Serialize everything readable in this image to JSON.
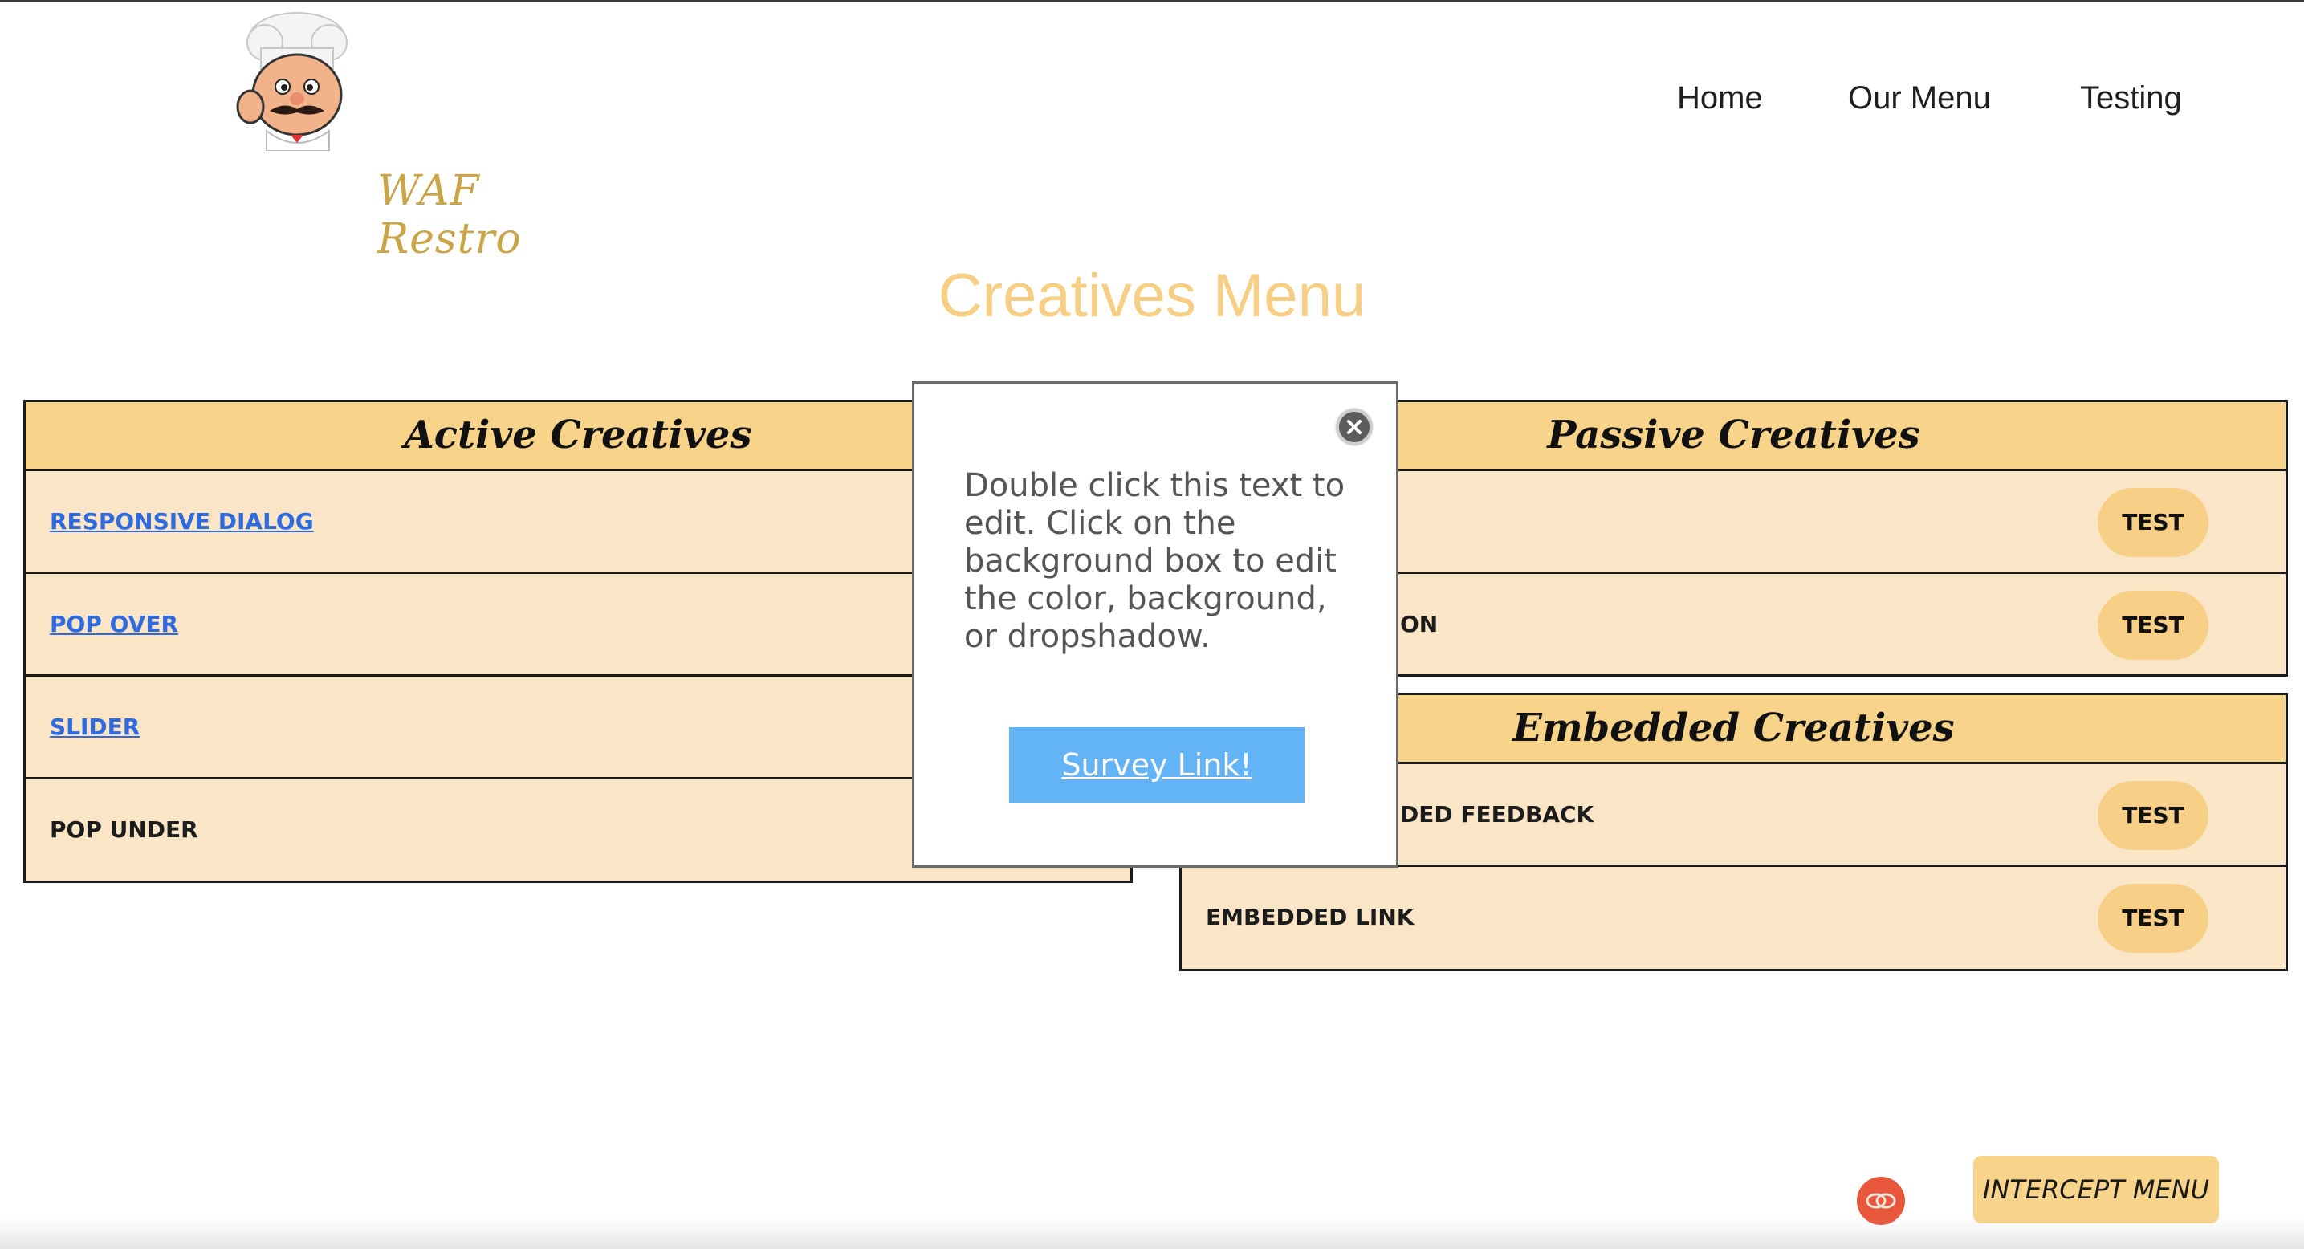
{
  "header": {
    "brand_name": "WAF Restro",
    "nav": [
      "Home",
      "Our Menu",
      "Testing"
    ]
  },
  "page_title": "Creatives Menu",
  "active_creatives": {
    "heading": "Active Creatives",
    "rows": [
      {
        "label": "RESPONSIVE DIALOG"
      },
      {
        "label": "POP OVER"
      },
      {
        "label": "SLIDER"
      },
      {
        "label": "POP UNDER"
      }
    ]
  },
  "passive_creatives": {
    "heading": "Passive Creatives",
    "rows": [
      {
        "label": "",
        "button": "TEST"
      },
      {
        "label": "ON",
        "button": "TEST"
      }
    ]
  },
  "embedded_creatives": {
    "heading": "Embedded Creatives",
    "rows": [
      {
        "label": "DED FEEDBACK",
        "button": "TEST"
      },
      {
        "label": "EMBEDDED LINK",
        "button": "TEST"
      }
    ]
  },
  "modal": {
    "text": "Double click this text to edit. Click on the background box to edit the color, background, or dropshadow.",
    "link_label": "Survey Link!"
  },
  "intercept_menu_label": "INTERCEPT MENU",
  "colors": {
    "title": "#f6cf85",
    "table_header": "#f8d38a",
    "table_row": "#fae5c7",
    "link": "#2e6be0",
    "survey_button": "#63b3f7",
    "intercept_icon": "#e8563b"
  }
}
